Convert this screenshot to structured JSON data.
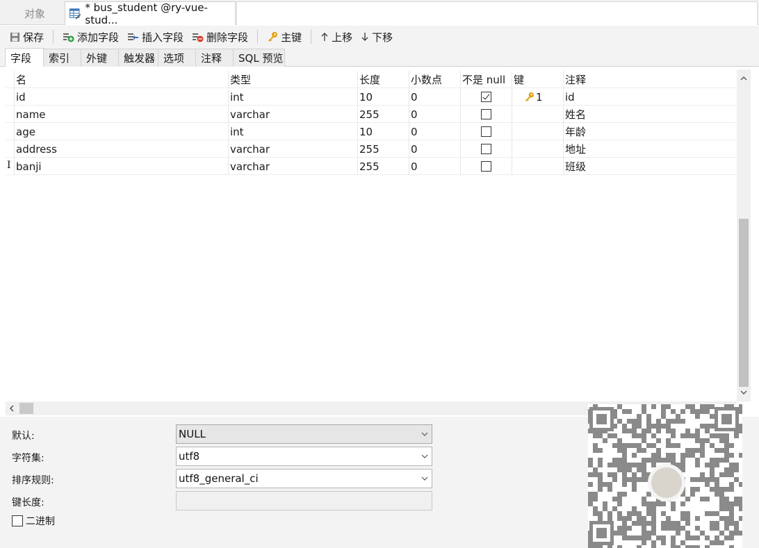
{
  "doc_tabs": {
    "inactive_label": "对象",
    "active_label": "* bus_student @ry-vue-stud..."
  },
  "toolbar": {
    "save": "保存",
    "add_field": "添加字段",
    "insert_field": "插入字段",
    "delete_field": "删除字段",
    "primary_key": "主键",
    "move_up": "上移",
    "move_down": "下移"
  },
  "subtabs": [
    "字段",
    "索引",
    "外键",
    "触发器",
    "选项",
    "注释",
    "SQL 预览"
  ],
  "columns": {
    "name": "名",
    "type": "类型",
    "length": "长度",
    "decimals": "小数点",
    "not_null": "不是 null",
    "key": "键",
    "comment": "注释"
  },
  "rows": [
    {
      "name": "id",
      "type": "int",
      "length": "10",
      "decimals": "0",
      "not_null": true,
      "key": "1",
      "comment": "id"
    },
    {
      "name": "name",
      "type": "varchar",
      "length": "255",
      "decimals": "0",
      "not_null": false,
      "key": "",
      "comment": "姓名"
    },
    {
      "name": "age",
      "type": "int",
      "length": "10",
      "decimals": "0",
      "not_null": false,
      "key": "",
      "comment": "年龄"
    },
    {
      "name": "address",
      "type": "varchar",
      "length": "255",
      "decimals": "0",
      "not_null": false,
      "key": "",
      "comment": "地址"
    },
    {
      "name": "banji",
      "type": "varchar",
      "length": "255",
      "decimals": "0",
      "not_null": false,
      "key": "",
      "comment": "班级"
    }
  ],
  "row_marker": "I",
  "props": {
    "default_label": "默认:",
    "default_value": "NULL",
    "charset_label": "字符集:",
    "charset_value": "utf8",
    "collation_label": "排序规则:",
    "collation_value": "utf8_general_ci",
    "key_length_label": "键长度:",
    "key_length_value": "",
    "binary_label": "二进制",
    "binary_checked": false
  },
  "colors": {
    "key_icon": "#e3a21a",
    "tab_bg": "#f0f0f0",
    "scroll_thumb": "#c1c1c1"
  }
}
